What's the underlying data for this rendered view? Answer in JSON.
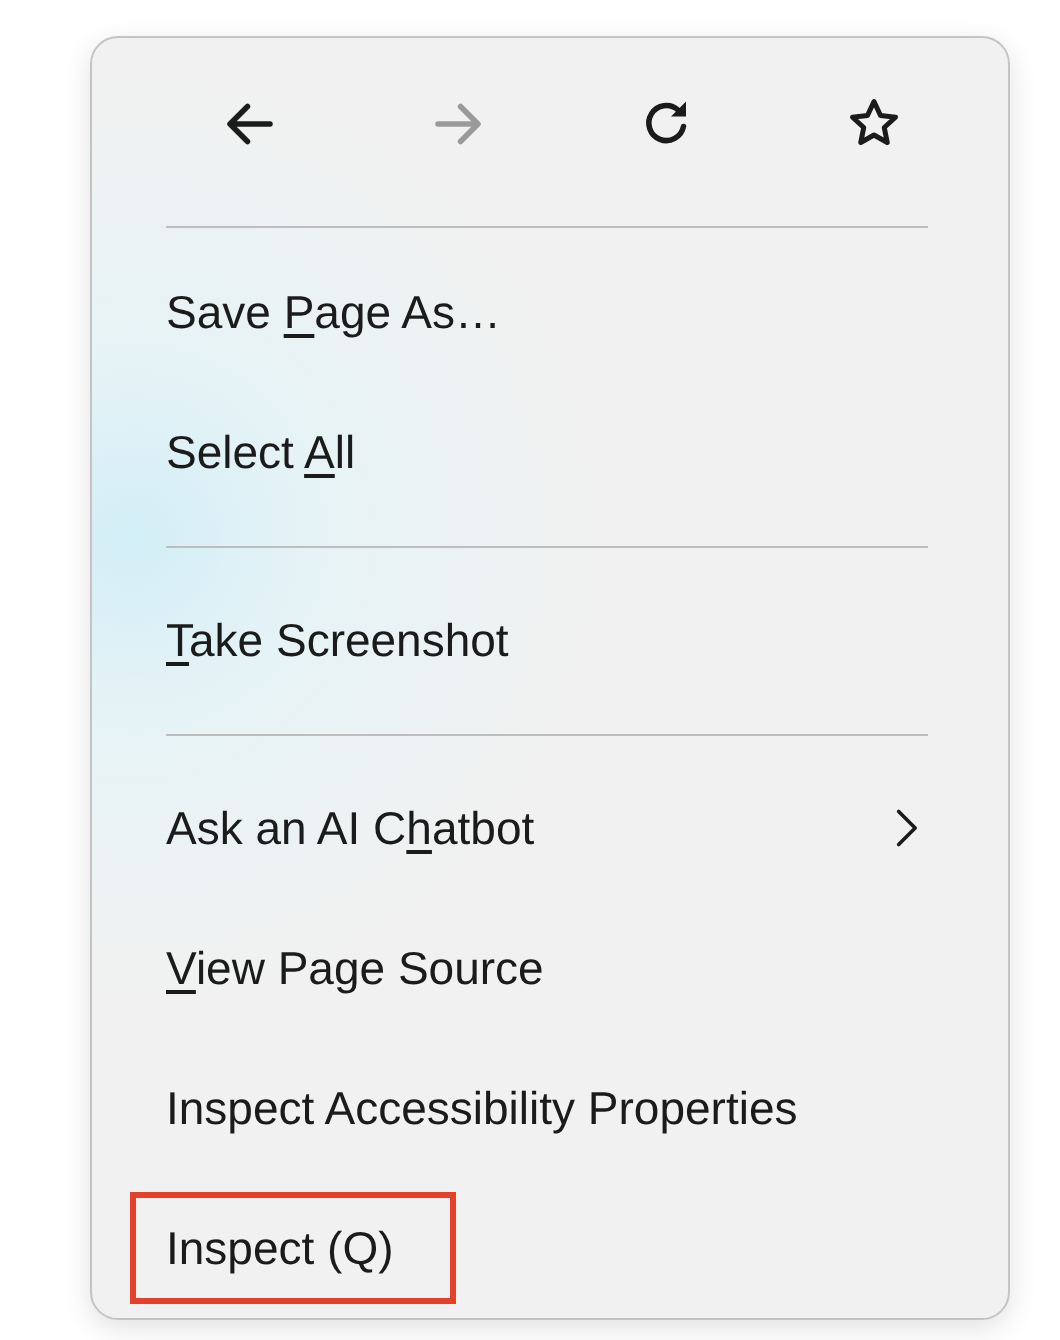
{
  "nav": [
    {
      "kind": "back",
      "disabled": false
    },
    {
      "kind": "forward",
      "disabled": true
    },
    {
      "kind": "reload",
      "disabled": false
    },
    {
      "kind": "bookmark",
      "disabled": false
    }
  ],
  "items": [
    {
      "kind": "item",
      "label_parts": [
        {
          "text": "Save ",
          "underline": false
        },
        {
          "text": "P",
          "underline": true
        },
        {
          "text": "age As…",
          "underline": false
        }
      ],
      "submenu": false,
      "highlighted": false
    },
    {
      "kind": "item",
      "label_parts": [
        {
          "text": "Select ",
          "underline": false
        },
        {
          "text": "A",
          "underline": true
        },
        {
          "text": "ll",
          "underline": false
        }
      ],
      "submenu": false,
      "highlighted": false
    },
    {
      "kind": "separator"
    },
    {
      "kind": "item",
      "label_parts": [
        {
          "text": "T",
          "underline": true
        },
        {
          "text": "ake Screenshot",
          "underline": false
        }
      ],
      "submenu": false,
      "highlighted": false
    },
    {
      "kind": "separator"
    },
    {
      "kind": "item",
      "label_parts": [
        {
          "text": "Ask an AI C",
          "underline": false
        },
        {
          "text": "h",
          "underline": true
        },
        {
          "text": "atbot",
          "underline": false
        }
      ],
      "submenu": true,
      "highlighted": false
    },
    {
      "kind": "item",
      "label_parts": [
        {
          "text": "V",
          "underline": true
        },
        {
          "text": "iew Page Source",
          "underline": false
        }
      ],
      "submenu": false,
      "highlighted": false
    },
    {
      "kind": "item",
      "label_parts": [
        {
          "text": "Inspect Accessibility Properties",
          "underline": false
        }
      ],
      "submenu": false,
      "highlighted": false
    },
    {
      "kind": "item",
      "label_parts": [
        {
          "text": "Inspect (Q)",
          "underline": false
        }
      ],
      "submenu": false,
      "highlighted": true
    }
  ]
}
